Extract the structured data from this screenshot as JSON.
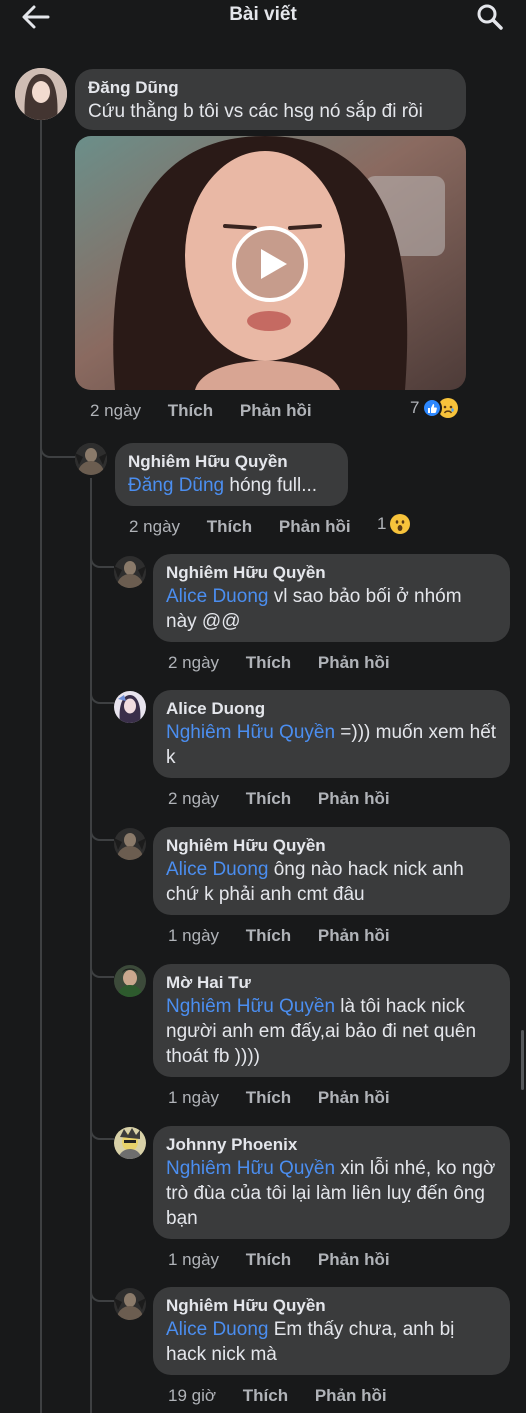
{
  "header": {
    "title": "Bài viết"
  },
  "comments": [
    {
      "author": "Đăng Dũng",
      "text": "Cứu thằng b tôi vs các hsg nó sắp đi rồi",
      "time": "2 ngày",
      "like": "Thích",
      "reply": "Phản hồi",
      "reaction_count": "7"
    },
    {
      "author": "Nghiêm Hữu Quyền",
      "mention": "Đăng Dũng",
      "text": " hóng full...",
      "time": "2 ngày",
      "like": "Thích",
      "reply": "Phản hồi",
      "reaction_count": "1"
    },
    {
      "author": "Nghiêm Hữu Quyền",
      "mention": "Alice Duong",
      "text": " vl sao bảo bối ở nhóm này @@",
      "time": "2 ngày",
      "like": "Thích",
      "reply": "Phản hồi"
    },
    {
      "author": "Alice Duong",
      "mention": "Nghiêm Hữu Quyền",
      "text": " =))) muốn xem hết k",
      "time": "2 ngày",
      "like": "Thích",
      "reply": "Phản hồi"
    },
    {
      "author": "Nghiêm Hữu Quyền",
      "mention": "Alice Duong",
      "text": " ông nào hack nick anh chứ k phải anh cmt đâu",
      "time": "1 ngày",
      "like": "Thích",
      "reply": "Phản hồi"
    },
    {
      "author": "Mờ Hai Tư",
      "mention": "Nghiêm Hữu Quyền",
      "text": " là tôi hack nick người anh em đấy,ai bảo đi net quên thoát fb ))))",
      "time": "1 ngày",
      "like": "Thích",
      "reply": "Phản hồi"
    },
    {
      "author": "Johnny Phoenix",
      "mention": "Nghiêm Hữu Quyền",
      "text": " xin lỗi nhé, ko ngờ trò đùa của tôi lại làm liên luỵ đến ông bạn",
      "time": "1 ngày",
      "like": "Thích",
      "reply": "Phản hồi"
    },
    {
      "author": "Nghiêm Hữu Quyền",
      "mention": "Alice Duong",
      "text": " Em thấy chưa, anh bị hack nick mà",
      "time": "19 giờ",
      "like": "Thích",
      "reply": "Phản hồi"
    }
  ],
  "icons": {
    "back": "arrow-left-icon",
    "search": "search-icon",
    "play": "play-icon",
    "like_reaction": "like-reaction-icon",
    "sad_reaction": "sad-reaction-icon",
    "wow_reaction": "wow-reaction-icon"
  },
  "colors": {
    "background": "#18191a",
    "bubble": "#3a3b3c",
    "mention": "#4b8ef0",
    "meta": "#b0b3b8"
  }
}
